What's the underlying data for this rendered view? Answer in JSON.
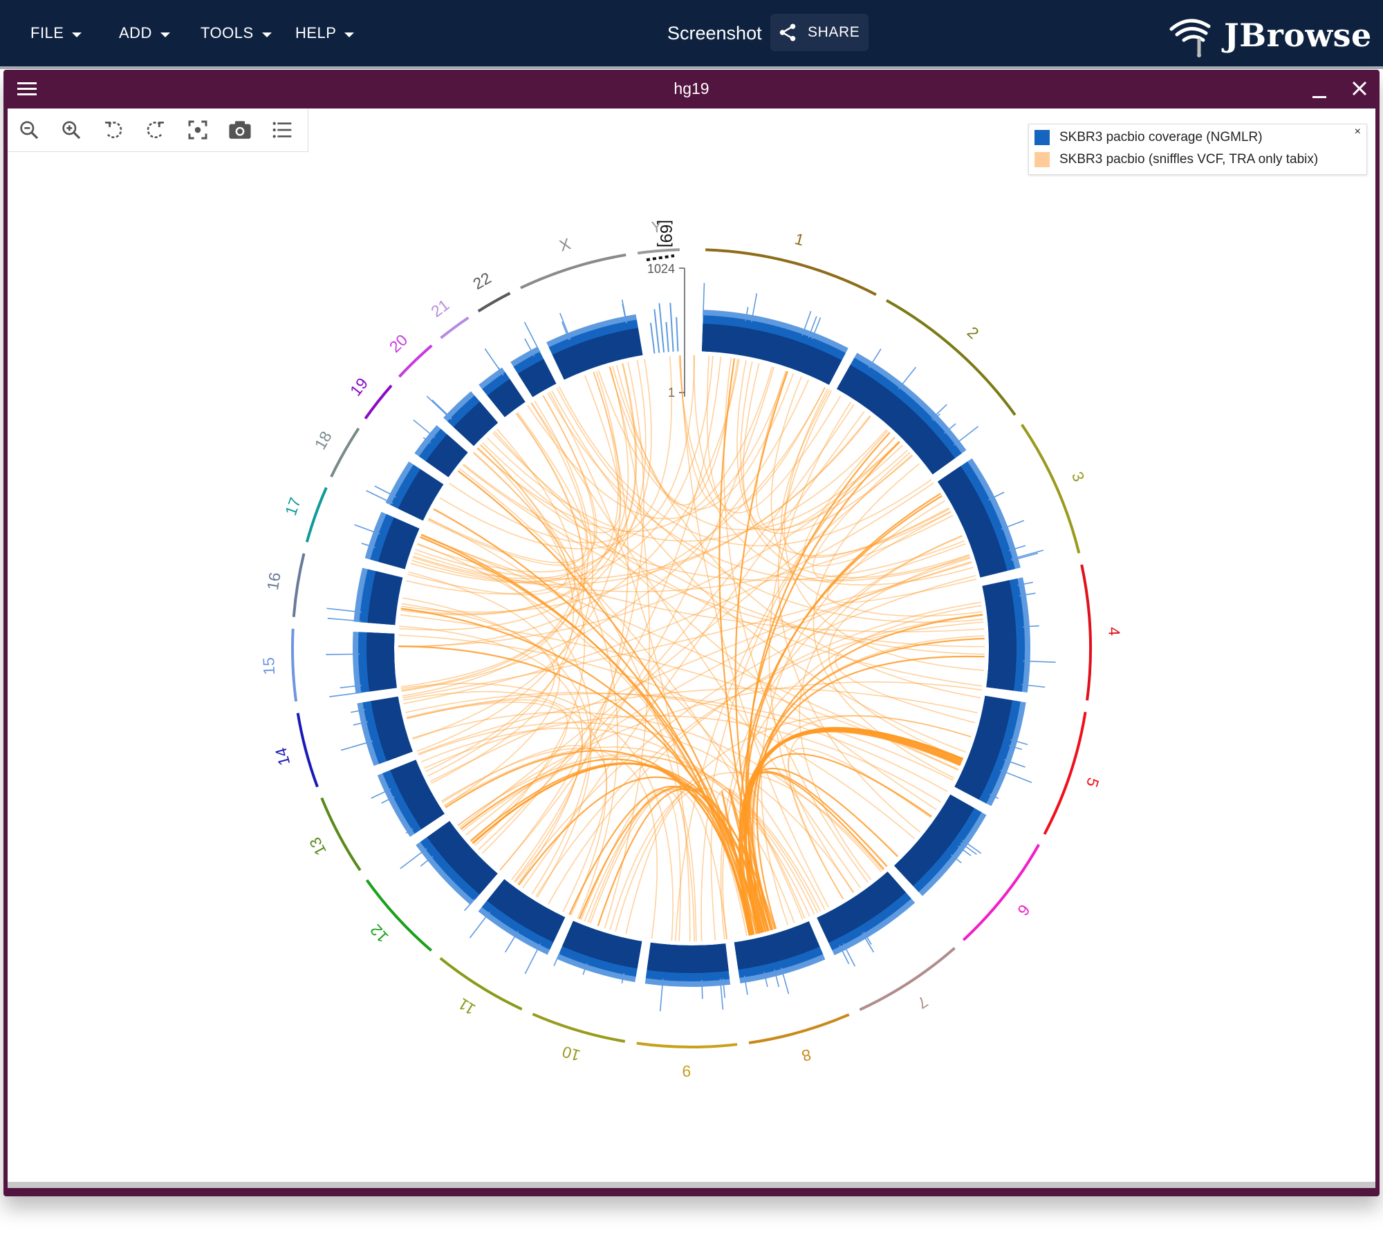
{
  "appbar": {
    "menus": [
      {
        "label": "FILE"
      },
      {
        "label": "ADD"
      },
      {
        "label": "TOOLS"
      },
      {
        "label": "HELP"
      }
    ],
    "title": "Screenshot",
    "share_label": "SHARE",
    "logo_text": "JBrowse"
  },
  "view": {
    "title": "hg19",
    "toolbar_icons": [
      "zoom-out-icon",
      "zoom-in-icon",
      "rotate-counterclockwise-icon",
      "rotate-clockwise-icon",
      "center-focus-icon",
      "camera-icon",
      "track-list-icon"
    ]
  },
  "legend": {
    "close_label": "×",
    "items": [
      {
        "label": "SKBR3 pacbio coverage (NGMLR)",
        "color": "#1565c0"
      },
      {
        "label": "SKBR3 pacbio (sniffles VCF, TRA only tabix)",
        "color": "#ffcc99"
      }
    ]
  },
  "colors": {
    "appbar": "#0e2240",
    "view_header": "#52153f",
    "coverage_dark": "#0d3f8a",
    "coverage_mid": "#1565c0",
    "coverage_light": "#5e9ae0",
    "arc": "#ff9a26"
  },
  "scale": {
    "max_label": "1024",
    "min_label": "1",
    "overflow_label": "[69]"
  },
  "chromosomes": [
    {
      "name": "1",
      "color": "#8e6c1a"
    },
    {
      "name": "2",
      "color": "#7b7a16"
    },
    {
      "name": "3",
      "color": "#9a9a1e"
    },
    {
      "name": "4",
      "color": "#e0101c"
    },
    {
      "name": "5",
      "color": "#f0101c"
    },
    {
      "name": "6",
      "color": "#f020c8"
    },
    {
      "name": "7",
      "color": "#b08c8c"
    },
    {
      "name": "8",
      "color": "#c88a1a"
    },
    {
      "name": "9",
      "color": "#c8a01a"
    },
    {
      "name": "10",
      "color": "#9a9a1e"
    },
    {
      "name": "11",
      "color": "#8a9a1a"
    },
    {
      "name": "12",
      "color": "#1aa01a"
    },
    {
      "name": "13",
      "color": "#5a8a1a"
    },
    {
      "name": "14",
      "color": "#1a1ab8"
    },
    {
      "name": "15",
      "color": "#6e96e0"
    },
    {
      "name": "16",
      "color": "#6a7a9a"
    },
    {
      "name": "17",
      "color": "#109a9a"
    },
    {
      "name": "18",
      "color": "#7a8a8a"
    },
    {
      "name": "19",
      "color": "#8a0ac8"
    },
    {
      "name": "20",
      "color": "#c83ae0"
    },
    {
      "name": "21",
      "color": "#b88ae0"
    },
    {
      "name": "22",
      "color": "#5a5a5a"
    },
    {
      "name": "X",
      "color": "#8a8a8a"
    },
    {
      "name": "Y",
      "color": "#9a9a9a"
    }
  ]
}
